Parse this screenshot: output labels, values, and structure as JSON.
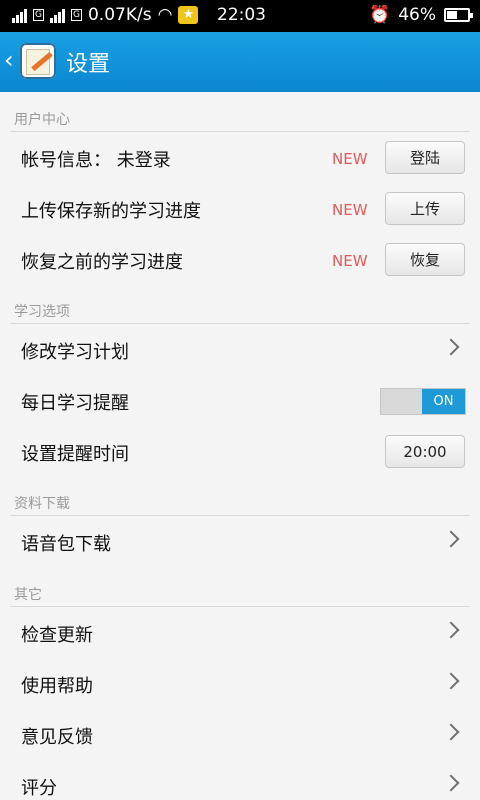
{
  "status_bar": {
    "network_speed": "0.07K/s",
    "time": "22:03",
    "battery": "46%",
    "battery_level": 0.46
  },
  "header": {
    "back_glyph": "‹",
    "title": "设置"
  },
  "sections": {
    "user_center": {
      "header": "用户中心",
      "account": {
        "label": "帐号信息：  未登录",
        "new_badge": "NEW",
        "button": "登陆"
      },
      "upload": {
        "label": "上传保存新的学习进度",
        "new_badge": "NEW",
        "button": "上传"
      },
      "restore": {
        "label": "恢复之前的学习进度",
        "new_badge": "NEW",
        "button": "恢复"
      }
    },
    "study_options": {
      "header": "学习选项",
      "modify_plan": {
        "label": "修改学习计划"
      },
      "daily_reminder": {
        "label": "每日学习提醒",
        "toggle": "ON"
      },
      "reminder_time": {
        "label": "设置提醒时间",
        "value": "20:00"
      }
    },
    "downloads": {
      "header": "资料下载",
      "voice_pack": {
        "label": "语音包下载"
      }
    },
    "other": {
      "header": "其它",
      "check_update": {
        "label": "检查更新"
      },
      "help": {
        "label": "使用帮助"
      },
      "feedback": {
        "label": "意见反馈"
      },
      "rate": {
        "label": "评分"
      }
    }
  },
  "colors": {
    "accent": "#0a86d0",
    "new_badge": "#e05c5c",
    "toggle_on": "#1e9ad6"
  }
}
